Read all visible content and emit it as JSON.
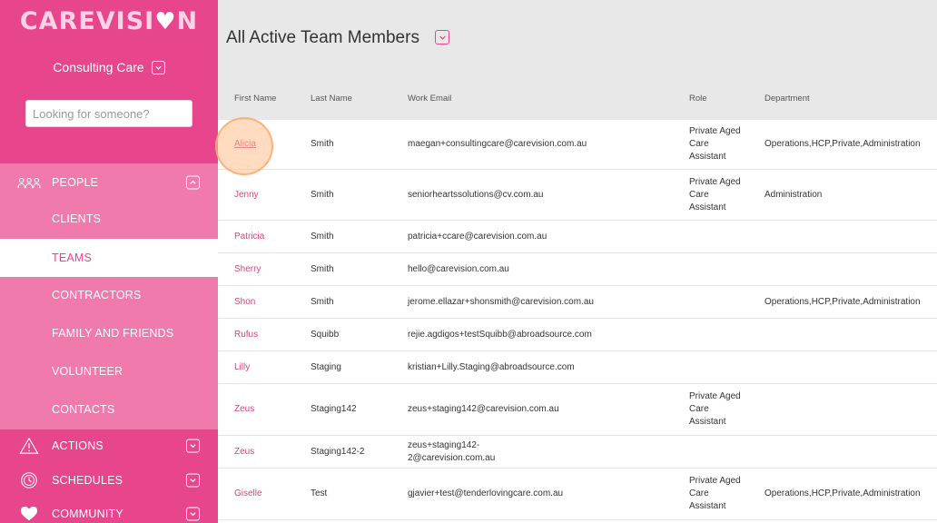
{
  "brand": {
    "logo_text": "CAREVISI",
    "logo_end": "N"
  },
  "org": {
    "name": "Consulting Care"
  },
  "search": {
    "placeholder": "Looking for someone?"
  },
  "nav": {
    "people": "PEOPLE",
    "clients": "CLIENTS",
    "teams": "TEAMS",
    "contractors": "CONTRACTORS",
    "family": "FAMILY AND FRIENDS",
    "volunteer": "VOLUNTEER",
    "contacts": "CONTACTS",
    "actions": "ACTIONS",
    "schedules": "SCHEDULES",
    "community": "COMMUNITY"
  },
  "page": {
    "title": "All Active Team Members"
  },
  "table": {
    "headers": {
      "first": "First Name",
      "last": "Last Name",
      "email": "Work Email",
      "role": "Role",
      "dept": "Department"
    },
    "rows": [
      {
        "first": "Alicia",
        "last": "Smith",
        "email": "maegan+consultingcare@carevision.com.au",
        "role": "Private Aged Care Assistant",
        "dept": "Operations,HCP,Private,Administration"
      },
      {
        "first": "Jenny",
        "last": "Smith",
        "email": "seniorheartssolutions@cv.com.au",
        "role": "Private Aged Care Assistant",
        "dept": "Administration"
      },
      {
        "first": "Patricia",
        "last": "Smith",
        "email": "patricia+ccare@carevision.com.au",
        "role": "",
        "dept": ""
      },
      {
        "first": "Sherry",
        "last": "Smith",
        "email": "hello@carevision.com.au",
        "role": "",
        "dept": ""
      },
      {
        "first": "Shon",
        "last": "Smith",
        "email": "jerome.ellazar+shonsmith@carevision.com.au",
        "role": "",
        "dept": "Operations,HCP,Private,Administration"
      },
      {
        "first": "Rufus",
        "last": "Squibb",
        "email": "rejie.agdigos+testSquibb@abroadsource.com",
        "role": "",
        "dept": ""
      },
      {
        "first": "Lilly",
        "last": "Staging",
        "email": "kristian+Lilly.Staging@abroadsource.com",
        "role": "",
        "dept": ""
      },
      {
        "first": "Zeus",
        "last": "Staging142",
        "email": "zeus+staging142@carevision.com.au",
        "role": "Private Aged Care Assistant",
        "dept": ""
      },
      {
        "first": "Zeus",
        "last": "Staging142-2",
        "email": "zeus+staging142-2@carevision.com.au",
        "role": "",
        "dept": ""
      },
      {
        "first": "Giselle",
        "last": "Test",
        "email": "gjavier+test@tenderlovingcare.com.au",
        "role": "Private Aged Care Assistant",
        "dept": "Operations,HCP,Private,Administration"
      }
    ]
  },
  "colors": {
    "accent": "#e7458c",
    "sidebar_light": "#f07aac",
    "header_bg": "#e8e8e8"
  }
}
